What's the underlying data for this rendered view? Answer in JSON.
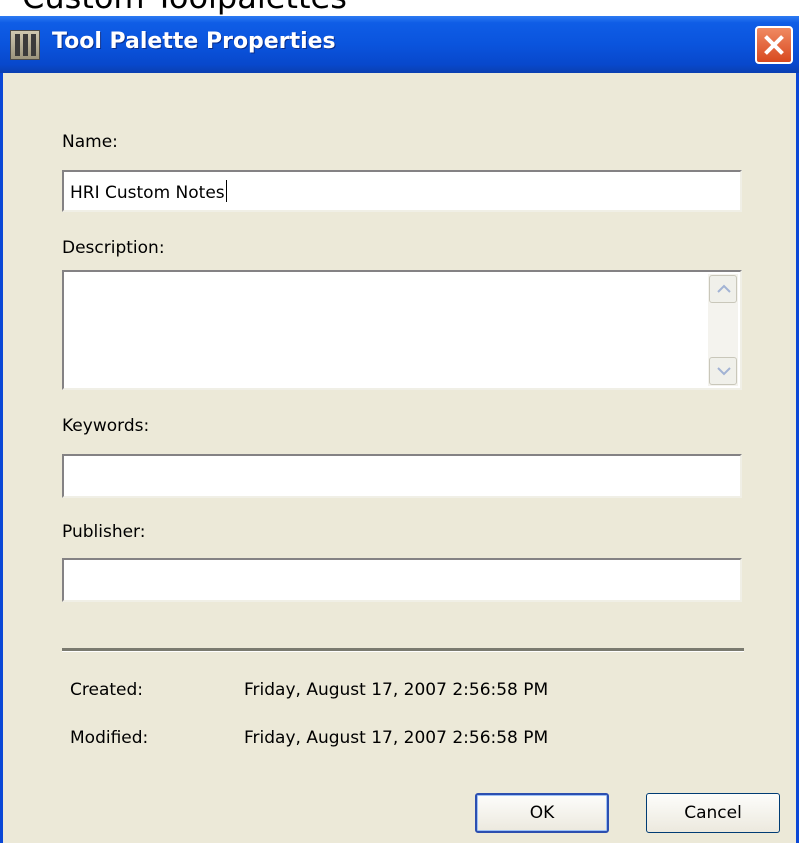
{
  "background_window": {
    "title_fragment": "Custom Toolpalettes"
  },
  "dialog": {
    "title": "Tool Palette Properties",
    "icon": "tool-palette-icon",
    "close_icon": "close-icon"
  },
  "form": {
    "name_label": "Name:",
    "name_value": "HRI Custom Notes",
    "description_label": "Description:",
    "description_value": "",
    "keywords_label": "Keywords:",
    "keywords_value": "",
    "publisher_label": "Publisher:",
    "publisher_value": ""
  },
  "info": {
    "created_label": "Created:",
    "created_value": "Friday, August 17, 2007 2:56:58 PM",
    "modified_label": "Modified:",
    "modified_value": "Friday, August 17, 2007 2:56:58 PM"
  },
  "buttons": {
    "ok": "OK",
    "cancel": "Cancel"
  },
  "colors": {
    "titlebar": "#0a54dd",
    "dialog_bg": "#ece9d8",
    "close_button": "#d8491f"
  }
}
